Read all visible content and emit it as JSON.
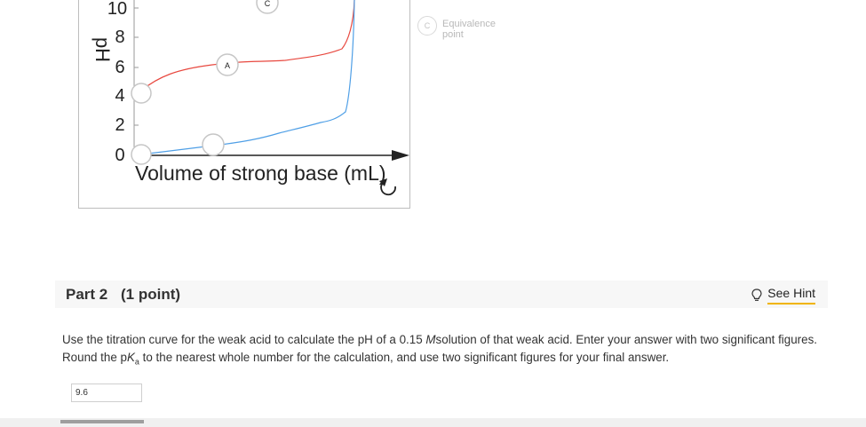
{
  "chart": {
    "ylabel": "pH",
    "xlabel": "Volume of strong base (mL)",
    "y_ticks": [
      "10",
      "8",
      "6",
      "4",
      "2",
      "0"
    ],
    "markers": {
      "a": "A",
      "c": "C"
    }
  },
  "chart_data": {
    "type": "line",
    "ylabel": "pH",
    "xlabel": "Volume of strong base (mL)",
    "ylim": [
      0,
      10
    ],
    "y_ticks": [
      10,
      8,
      6,
      4,
      2,
      0
    ],
    "series": [
      {
        "color": "#e8483f",
        "points": [
          [
            0,
            4.0
          ],
          [
            0.3,
            5.2
          ],
          [
            0.8,
            5.9
          ],
          [
            0.96,
            6.6
          ],
          [
            1.0,
            10.5
          ]
        ]
      },
      {
        "color": "#4f9fe6",
        "points": [
          [
            0,
            0.1
          ],
          [
            0.3,
            0.2
          ],
          [
            0.8,
            0.8
          ],
          [
            0.96,
            1.4
          ],
          [
            1.0,
            10.5
          ]
        ]
      }
    ],
    "annotations": [
      "A",
      "C"
    ]
  },
  "legend": {
    "marker": "C",
    "text_line1": "Equivalence",
    "text_line2": "point"
  },
  "part": {
    "title": "Part 2",
    "points": "(1 point)"
  },
  "hint": {
    "label": "See Hint"
  },
  "question": {
    "text1": "Use the titration curve for the weak acid to calculate the pH of a 0.15 ",
    "unit": "M",
    "text2": "solution of that weak acid. Enter your answer with two significant figures. Round the p",
    "ka_k": "K",
    "ka_sub": "a",
    "text3": " to the nearest whole number for the calculation, and use two significant figures for your final answer."
  },
  "answer": {
    "value": "9.6"
  },
  "colors": {
    "acid_curve": "#e8483f",
    "base_curve": "#4f9fe6",
    "hint_underline": "#f0b400"
  }
}
